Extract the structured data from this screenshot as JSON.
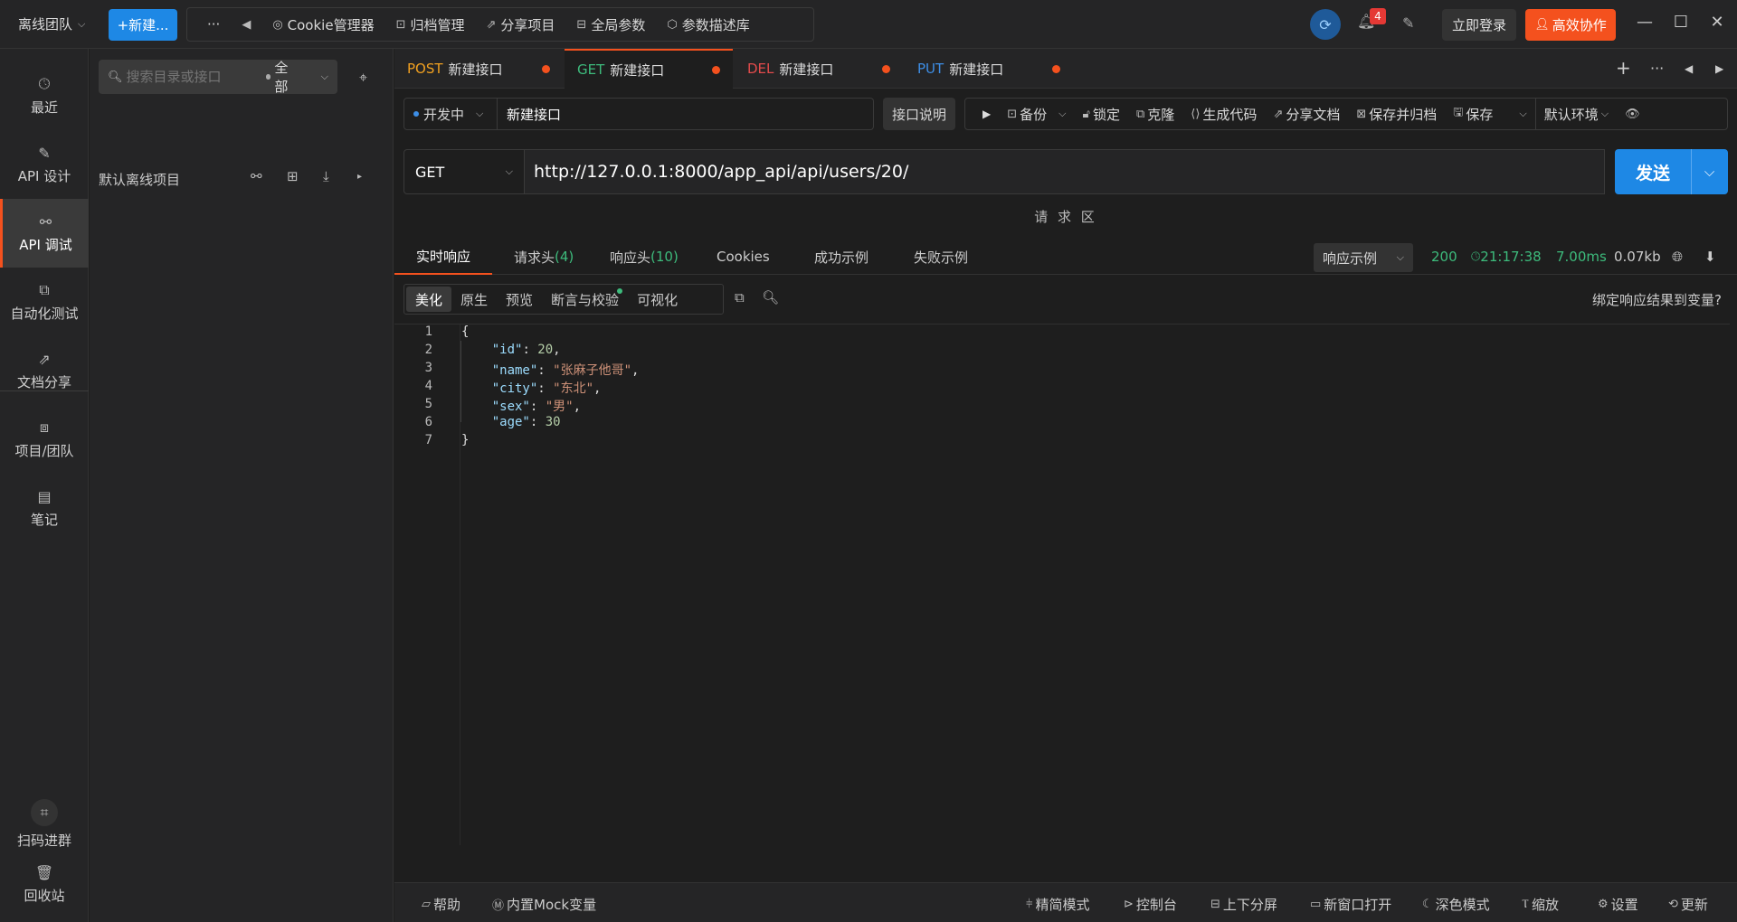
{
  "topbar": {
    "team": "离线团队",
    "new_button": "+新建...",
    "more": "···",
    "tools": [
      "Cookie管理器",
      "归档管理",
      "分享项目",
      "全局参数",
      "参数描述库"
    ],
    "notification_count": "4",
    "login": "立即登录",
    "collab": "高效协作"
  },
  "leftnav": {
    "items": [
      "最近",
      "API 设计",
      "API 调试",
      "自动化测试",
      "文档分享",
      "项目/团队",
      "笔记"
    ],
    "active": "API 调试",
    "bottom": [
      "扫码进群",
      "回收站"
    ]
  },
  "tree": {
    "search_placeholder": "搜索目录或接口",
    "filter": "全部",
    "project": "默认离线项目"
  },
  "tabs": [
    {
      "method": "POST",
      "name": "新建接口"
    },
    {
      "method": "GET",
      "name": "新建接口"
    },
    {
      "method": "DEL",
      "name": "新建接口"
    },
    {
      "method": "PUT",
      "name": "新建接口"
    }
  ],
  "request": {
    "status": "开发中",
    "name": "新建接口",
    "desc_button": "接口说明",
    "actions": [
      "备份",
      "锁定",
      "克隆",
      "生成代码",
      "分享文档",
      "保存并归档",
      "保存"
    ],
    "env": "默认环境",
    "method": "GET",
    "url": "http://127.0.0.1:8000/app_api/api/users/20/",
    "send": "发送",
    "area_label": "请 求 区"
  },
  "response": {
    "tabs": [
      "实时响应",
      "请求头",
      "响应头",
      "Cookies",
      "成功示例",
      "失败示例"
    ],
    "req_header_count": "(4)",
    "resp_header_count": "(10)",
    "example_select": "响应示例",
    "status_code": "200",
    "time": "21:17:38",
    "duration": "7.00ms",
    "size": "0.07kb",
    "subtabs": [
      "美化",
      "原生",
      "预览",
      "断言与校验",
      "可视化"
    ],
    "bind_var": "绑定响应结果到变量?",
    "body": {
      "line_numbers": [
        "1",
        "2",
        "3",
        "4",
        "5",
        "6",
        "7"
      ],
      "id": "20",
      "name": "\"张麻子他哥\"",
      "city": "\"东北\"",
      "sex": "\"男\"",
      "age": "30"
    }
  },
  "bottombar": {
    "left": [
      "帮助",
      "内置Mock变量"
    ],
    "right": [
      "精简模式",
      "控制台",
      "上下分屏",
      "新窗口打开",
      "深色模式",
      "缩放",
      "设置",
      "更新"
    ]
  }
}
